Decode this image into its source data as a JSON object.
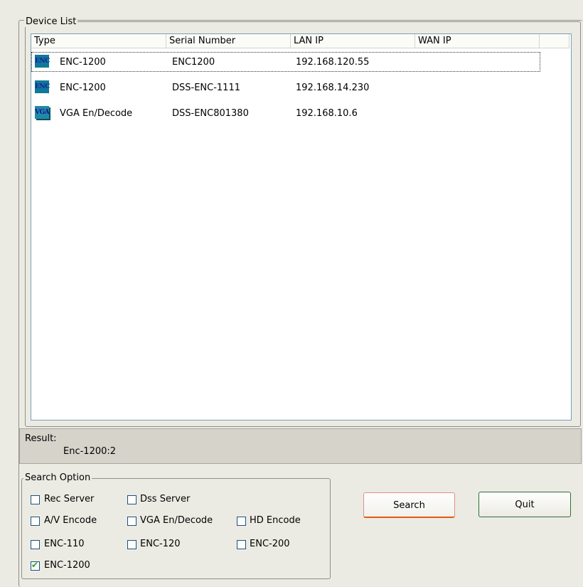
{
  "device_list": {
    "title": "Device List",
    "columns": [
      "Type",
      "Serial Number",
      "LAN IP",
      "WAN IP"
    ],
    "rows": [
      {
        "icon": "ENC",
        "type": "ENC-1200",
        "serial": "ENC1200",
        "lan_ip": "192.168.120.55",
        "wan_ip": ""
      },
      {
        "icon": "ENC",
        "type": "ENC-1200",
        "serial": "DSS-ENC-1111",
        "lan_ip": "192.168.14.230",
        "wan_ip": ""
      },
      {
        "icon": "VGA",
        "type": "VGA En/Decode",
        "serial": "DSS-ENC801380",
        "lan_ip": "192.168.10.6",
        "wan_ip": ""
      }
    ]
  },
  "result": {
    "label": "Result:",
    "value": "Enc-1200:2"
  },
  "search_option": {
    "title": "Search Option",
    "options": [
      {
        "label": "Rec Server",
        "checked": false
      },
      {
        "label": "Dss Server",
        "checked": false
      },
      {
        "label": "A/V Encode",
        "checked": false
      },
      {
        "label": "VGA En/Decode",
        "checked": false
      },
      {
        "label": "HD Encode",
        "checked": false
      },
      {
        "label": "ENC-110",
        "checked": false
      },
      {
        "label": "ENC-120",
        "checked": false
      },
      {
        "label": "ENC-200",
        "checked": false
      },
      {
        "label": "ENC-1200",
        "checked": true
      }
    ]
  },
  "buttons": {
    "search": "Search",
    "quit": "Quit"
  }
}
